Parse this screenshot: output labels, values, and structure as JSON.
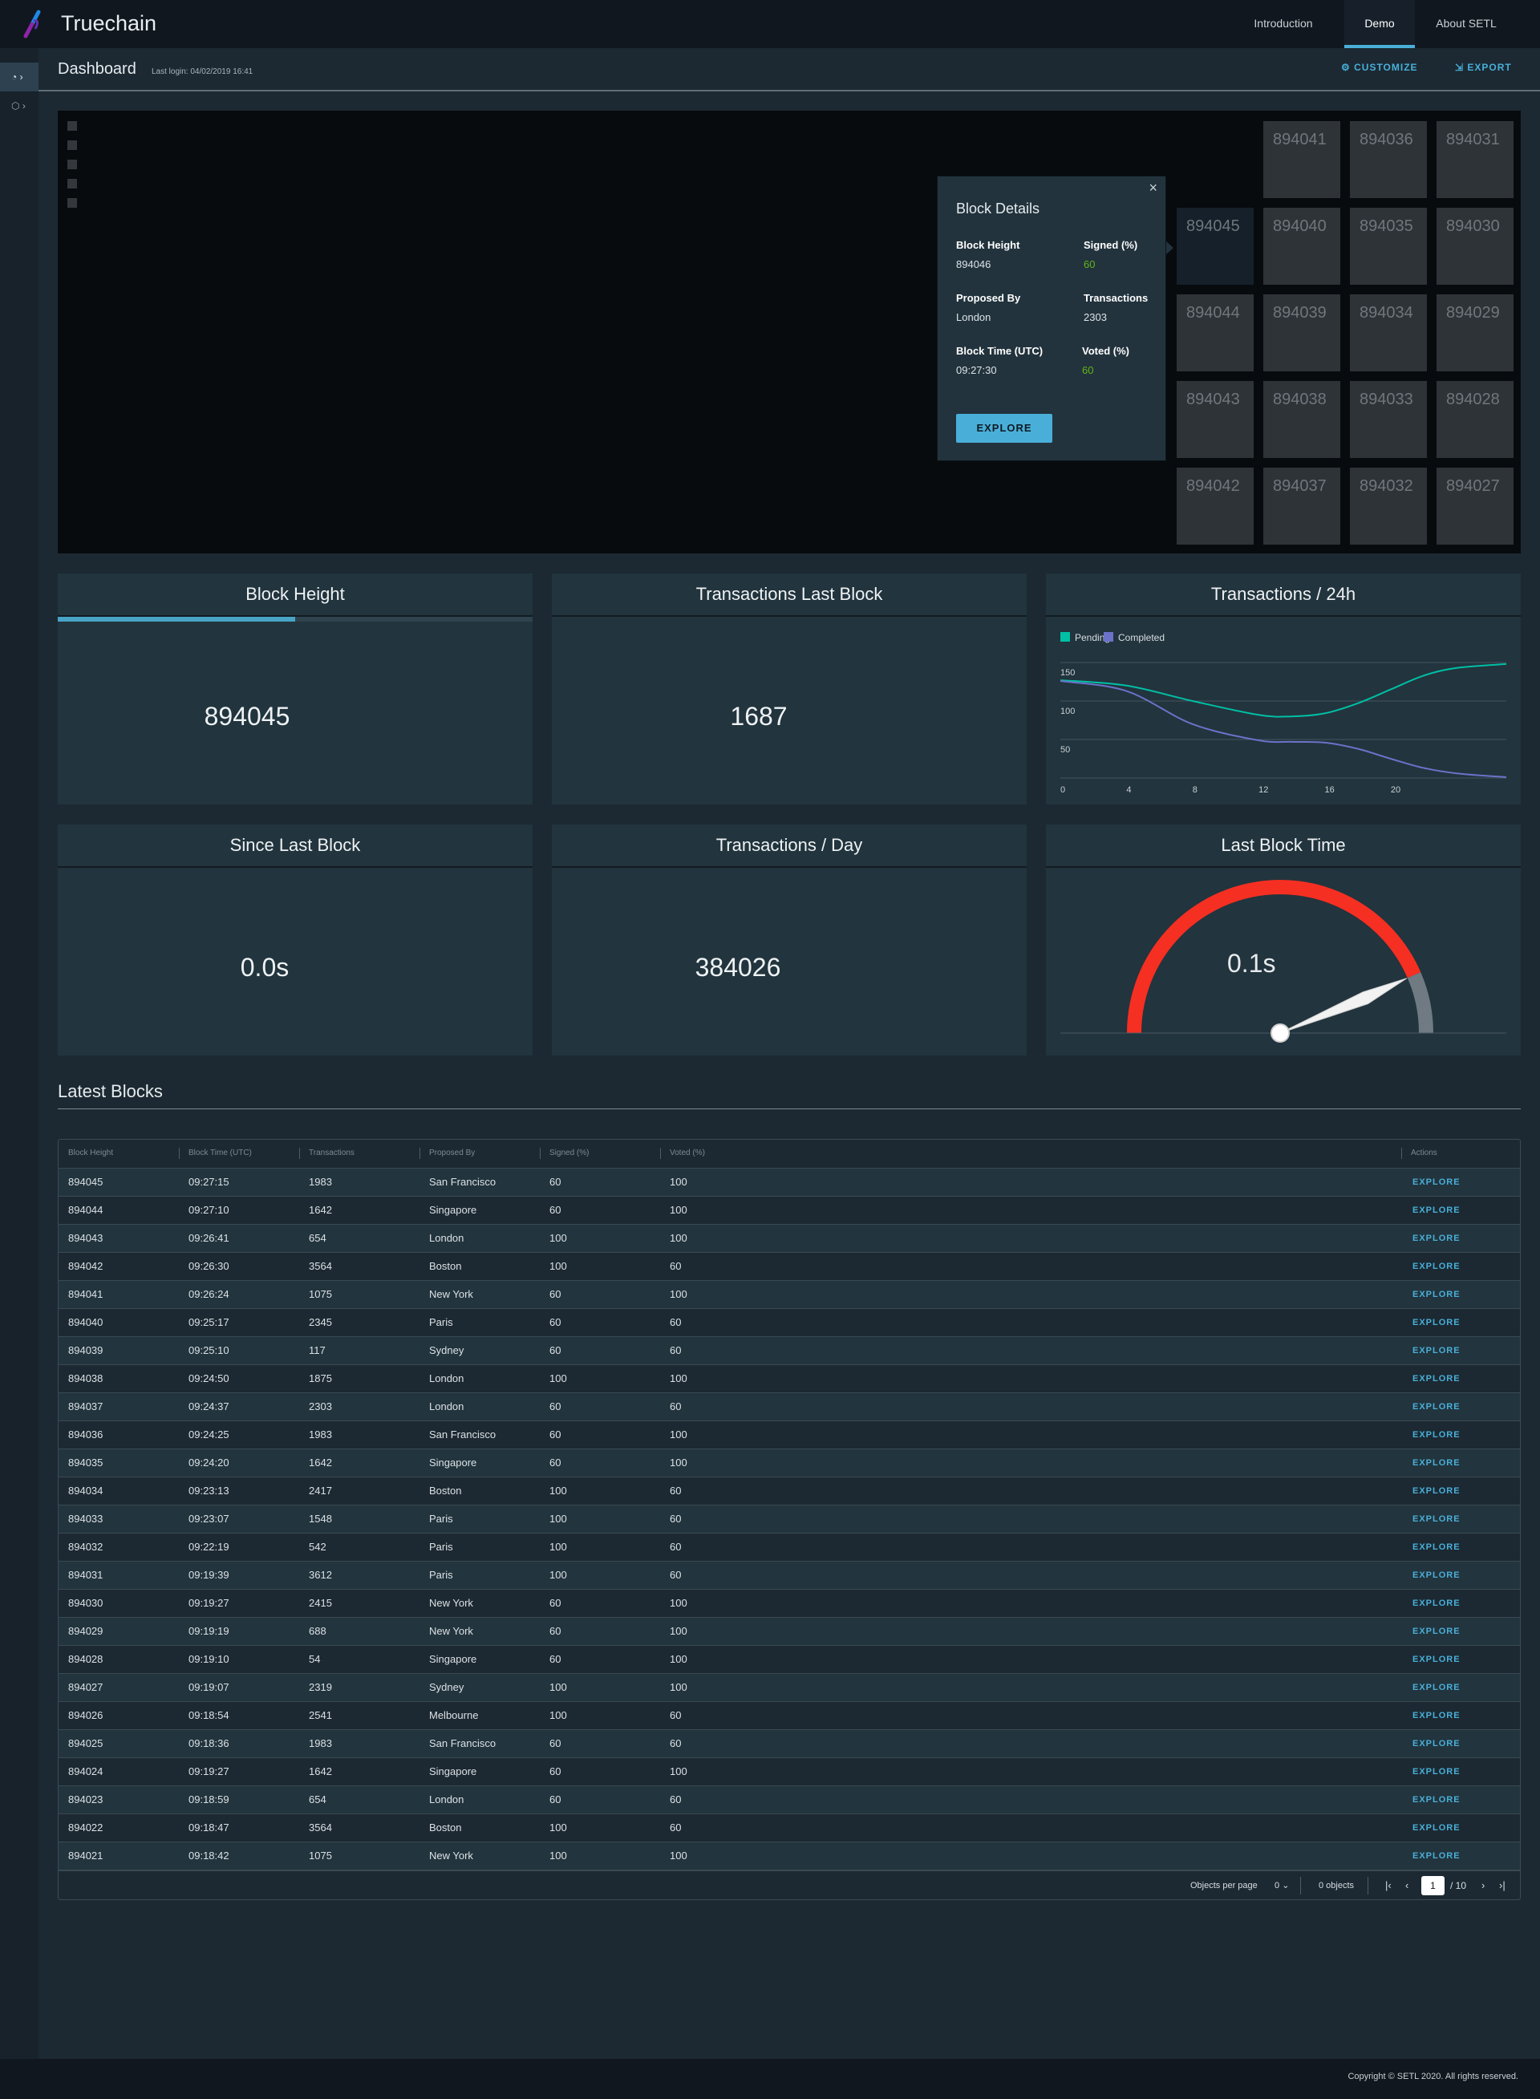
{
  "app": {
    "brand": "Truechain",
    "nav": [
      {
        "label": "Introduction",
        "active": false
      },
      {
        "label": "Demo",
        "active": true
      },
      {
        "label": "About SETL",
        "active": false
      }
    ]
  },
  "sidebar": {
    "items": [
      {
        "icon": "dashboard-icon",
        "active": true
      },
      {
        "icon": "cube-icon",
        "active": false
      }
    ]
  },
  "header": {
    "title": "Dashboard",
    "last_login": "Last login: 04/02/2019 16:41",
    "customize": "CUSTOMIZE",
    "export": "EXPORT"
  },
  "blocks_grid": [
    [
      null,
      "894041",
      "894036",
      "894031"
    ],
    [
      "894045",
      "894040",
      "894035",
      "894030"
    ],
    [
      "894044",
      "894039",
      "894034",
      "894029"
    ],
    [
      "894043",
      "894038",
      "894033",
      "894028"
    ],
    [
      "894042",
      "894037",
      "894032",
      "894027"
    ]
  ],
  "selected_block": "894045",
  "popover": {
    "title": "Block Details",
    "fields": [
      {
        "label": "Block Height",
        "value": "894046"
      },
      {
        "label": "Signed (%)",
        "value": "60",
        "color": "#60b515"
      },
      {
        "label": "Proposed By",
        "value": "London"
      },
      {
        "label": "Transactions",
        "value": "2303"
      },
      {
        "label": "Block Time (UTC)",
        "value": "09:27:30"
      },
      {
        "label": "Voted (%)",
        "value": "60",
        "color": "#60b515"
      }
    ],
    "button": "EXPLORE"
  },
  "cards": {
    "block_height": {
      "title": "Block Height",
      "value": "894045",
      "progress": 0.5
    },
    "tx_last_block": {
      "title": "Transactions Last Block",
      "value": "1687"
    },
    "tx_24h": {
      "title": "Transactions / 24h"
    },
    "since_last": {
      "title": "Since Last Block",
      "value": "0.0s"
    },
    "tx_day": {
      "title": "Transactions / Day",
      "value": "384026"
    },
    "last_block_time": {
      "title": "Last Block Time",
      "value": "0.1s",
      "gauge_fraction": 0.87
    }
  },
  "chart_data": {
    "type": "line",
    "legend": "top-left",
    "grid": true,
    "x_ticks": [
      0,
      4,
      8,
      12,
      16,
      20
    ],
    "y_ticks": [
      50,
      100,
      150
    ],
    "xlim": [
      0,
      27
    ],
    "ylim": [
      0,
      150
    ],
    "x": [
      0,
      4,
      8,
      12,
      14,
      16,
      18,
      20,
      22,
      24,
      27
    ],
    "series": [
      {
        "name": "Pending",
        "color": "#00bfa5",
        "values": [
          127,
          120,
          100,
          82,
          80,
          84,
          97,
          115,
          133,
          143,
          148
        ]
      },
      {
        "name": "Completed",
        "color": "#6b72c9",
        "values": [
          126,
          113,
          70,
          49,
          47,
          46,
          38,
          25,
          13,
          6,
          1
        ]
      }
    ]
  },
  "table": {
    "title": "Latest Blocks",
    "columns": [
      "Block Height",
      "Block Time (UTC)",
      "Transactions",
      "Proposed By",
      "Signed (%)",
      "Voted (%)",
      "Actions"
    ],
    "action_label": "EXPLORE",
    "rows": [
      [
        "894045",
        "09:27:15",
        "1983",
        "San Francisco",
        "60",
        "100"
      ],
      [
        "894044",
        "09:27:10",
        "1642",
        "Singapore",
        "60",
        "100"
      ],
      [
        "894043",
        "09:26:41",
        "654",
        "London",
        "100",
        "100"
      ],
      [
        "894042",
        "09:26:30",
        "3564",
        "Boston",
        "100",
        "60"
      ],
      [
        "894041",
        "09:26:24",
        "1075",
        "New York",
        "60",
        "100"
      ],
      [
        "894040",
        "09:25:17",
        "2345",
        "Paris",
        "60",
        "60"
      ],
      [
        "894039",
        "09:25:10",
        "117",
        "Sydney",
        "60",
        "60"
      ],
      [
        "894038",
        "09:24:50",
        "1875",
        "London",
        "100",
        "100"
      ],
      [
        "894037",
        "09:24:37",
        "2303",
        "London",
        "60",
        "60"
      ],
      [
        "894036",
        "09:24:25",
        "1983",
        "San Francisco",
        "60",
        "100"
      ],
      [
        "894035",
        "09:24:20",
        "1642",
        "Singapore",
        "60",
        "100"
      ],
      [
        "894034",
        "09:23:13",
        "2417",
        "Boston",
        "100",
        "60"
      ],
      [
        "894033",
        "09:23:07",
        "1548",
        "Paris",
        "100",
        "60"
      ],
      [
        "894032",
        "09:22:19",
        "542",
        "Paris",
        "100",
        "60"
      ],
      [
        "894031",
        "09:19:39",
        "3612",
        "Paris",
        "100",
        "60"
      ],
      [
        "894030",
        "09:19:27",
        "2415",
        "New York",
        "60",
        "100"
      ],
      [
        "894029",
        "09:19:19",
        "688",
        "New York",
        "60",
        "100"
      ],
      [
        "894028",
        "09:19:10",
        "54",
        "Singapore",
        "60",
        "100"
      ],
      [
        "894027",
        "09:19:07",
        "2319",
        "Sydney",
        "100",
        "100"
      ],
      [
        "894026",
        "09:18:54",
        "2541",
        "Melbourne",
        "100",
        "60"
      ],
      [
        "894025",
        "09:18:36",
        "1983",
        "San Francisco",
        "60",
        "60"
      ],
      [
        "894024",
        "09:19:27",
        "1642",
        "Singapore",
        "60",
        "100"
      ],
      [
        "894023",
        "09:18:59",
        "654",
        "London",
        "60",
        "60"
      ],
      [
        "894022",
        "09:18:47",
        "3564",
        "Boston",
        "100",
        "60"
      ],
      [
        "894021",
        "09:18:42",
        "1075",
        "New York",
        "100",
        "100"
      ]
    ],
    "pagination": {
      "per_page_label": "Objects per page",
      "per_page_value": "0",
      "count": "0 objects",
      "page": "1",
      "total": "/ 10"
    }
  },
  "footer": {
    "copyright": "Copyright © SETL 2020. All rights reserved."
  },
  "colors": {
    "accent": "#49afd9",
    "gauge_red": "#f52f22",
    "gauge_gray": "#6f7a83",
    "green": "#60b515"
  }
}
